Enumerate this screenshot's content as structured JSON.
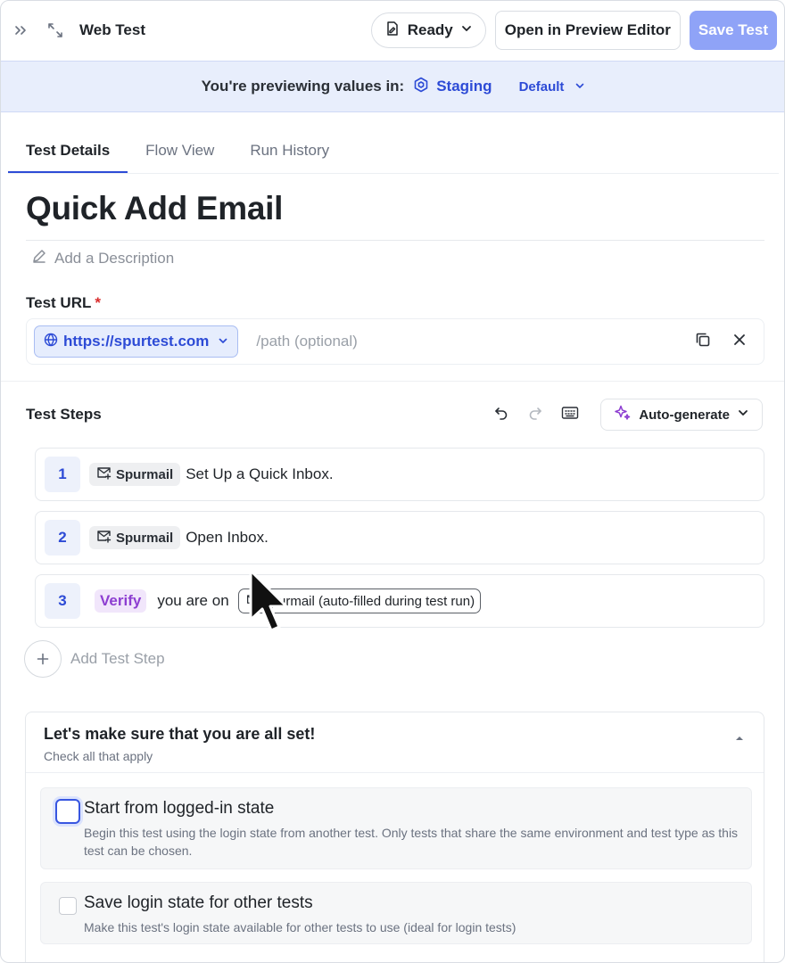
{
  "header": {
    "title": "Web Test",
    "status_label": "Ready",
    "preview_editor_label": "Open in Preview Editor",
    "save_label": "Save Test"
  },
  "banner": {
    "label": "You're previewing values in:",
    "environment": "Staging",
    "variant": "Default"
  },
  "tabs": [
    {
      "label": "Test Details",
      "active": true
    },
    {
      "label": "Flow View",
      "active": false
    },
    {
      "label": "Run History",
      "active": false
    }
  ],
  "test": {
    "name": "Quick Add Email",
    "description_placeholder": "Add a Description"
  },
  "url": {
    "label": "Test URL",
    "required_marker": "*",
    "domain": "https://spurtest.com",
    "path_placeholder": "/path (optional)"
  },
  "steps": {
    "title": "Test Steps",
    "autogenerate_label": "Auto-generate",
    "items": [
      {
        "number": "1",
        "tag": "Spurmail",
        "text": "Set Up a Quick Inbox."
      },
      {
        "number": "2",
        "tag": "Spurmail",
        "text": "Open Inbox."
      },
      {
        "number": "3",
        "verify": "Verify",
        "text": "you are on",
        "variable": "Spurmail (auto-filled during test run)"
      }
    ],
    "add_label": "Add Test Step"
  },
  "setup": {
    "title": "Let's make sure that you are all set!",
    "subtitle": "Check all that apply",
    "options": [
      {
        "title": "Start from logged-in state",
        "description": "Begin this test using the login state from another test. Only tests that share the same environment and test type as this test can be chosen."
      },
      {
        "title": "Save login state for other tests",
        "description": "Make this test's login state available for other tests to use (ideal for login tests)"
      }
    ]
  },
  "colors": {
    "accent": "#2d4bd6",
    "save_button": "#8fa3f7",
    "banner_bg": "#e8eefc",
    "verify_text": "#8d3ed1",
    "required": "#d92d2d"
  },
  "icons": [
    "collapse-sidebar-icon",
    "expand-icon",
    "draft-icon",
    "chevron-down-icon",
    "environment-icon",
    "pencil-icon",
    "globe-icon",
    "copy-icon",
    "close-icon",
    "undo-icon",
    "redo-icon",
    "keyboard-icon",
    "sparkle-icon",
    "mail-icon",
    "plus-icon",
    "chevron-up-icon",
    "cursor-pointer"
  ]
}
